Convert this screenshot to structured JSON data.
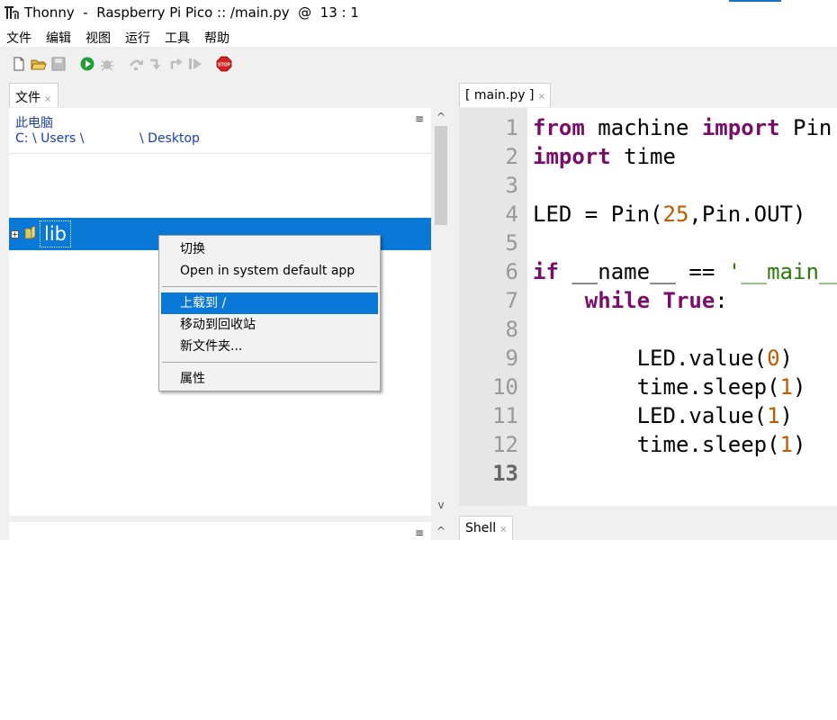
{
  "window": {
    "title": "Thonny  -  Raspberry Pi Pico :: /main.py  @  13 : 1",
    "app_icon": "thonny-logo-icon"
  },
  "menubar": {
    "items": [
      "文件",
      "编辑",
      "视图",
      "运行",
      "工具",
      "帮助"
    ]
  },
  "toolbar": {
    "buttons": [
      "new-file-icon",
      "open-file-icon",
      "save-file-icon",
      "run-icon",
      "debug-icon",
      "step-over-icon",
      "step-into-icon",
      "step-out-icon",
      "resume-icon",
      "stop-icon"
    ],
    "stop_label": "STOP",
    "colors": {
      "run": "#1f9e3a",
      "stop": "#d42020",
      "disabled": "#bdbdbd"
    }
  },
  "files_panel": {
    "tab_label": "文件",
    "tab_close": "×",
    "location_title": "此电脑",
    "path_left": "C: \\ Users \\",
    "path_right": "\\ Desktop",
    "menu_icon": "≡",
    "scroll_up": "^",
    "scroll_down": "v",
    "folder_name": "lib",
    "expand_symbol": "+"
  },
  "context_menu": {
    "item_switch": "切换",
    "item_open_default": "Open in system default app",
    "item_upload": "上载到 /",
    "item_move_recycle": "移动到回收站",
    "item_new_folder": "新文件夹...",
    "item_properties": "属性"
  },
  "editor": {
    "tab_label": "[ main.py ]",
    "tab_close": "×",
    "line_numbers": [
      "1",
      "2",
      "3",
      "4",
      "5",
      "6",
      "7",
      "8",
      "9",
      "10",
      "11",
      "12",
      "13"
    ],
    "current_line": "13",
    "code": {
      "l1_kw1": "from",
      "l1_a": " machine ",
      "l1_kw2": "import",
      "l1_b": " Pin",
      "l2_kw": "import",
      "l2_a": " time",
      "l4_a": "LED = Pin(",
      "l4_num": "25",
      "l4_b": ",Pin.OUT)",
      "l6_kw": "if",
      "l6_a": " __name__ == ",
      "l6_str": "'__main__'",
      "l6_b": ":",
      "l7_indent": "    ",
      "l7_kw1": "while",
      "l7_a": " ",
      "l7_kw2": "True",
      "l7_b": ":",
      "l9_a": "        LED.value(",
      "l9_num": "0",
      "l9_b": ")",
      "l10_a": "        time.sleep(",
      "l10_num": "1",
      "l10_b": ")",
      "l11_a": "        LED.value(",
      "l11_num": "1",
      "l11_b": ")",
      "l12_a": "        time.sleep(",
      "l12_num": "1",
      "l12_b": ")"
    },
    "syntax_colors": {
      "keyword": "#7a0d6b",
      "number": "#c05a00",
      "string": "#2b7a0b",
      "gutter_bg": "#e6e6e6",
      "line_number": "#999999"
    }
  },
  "shell_panel": {
    "tab_label": "Shell",
    "tab_close": "×"
  }
}
